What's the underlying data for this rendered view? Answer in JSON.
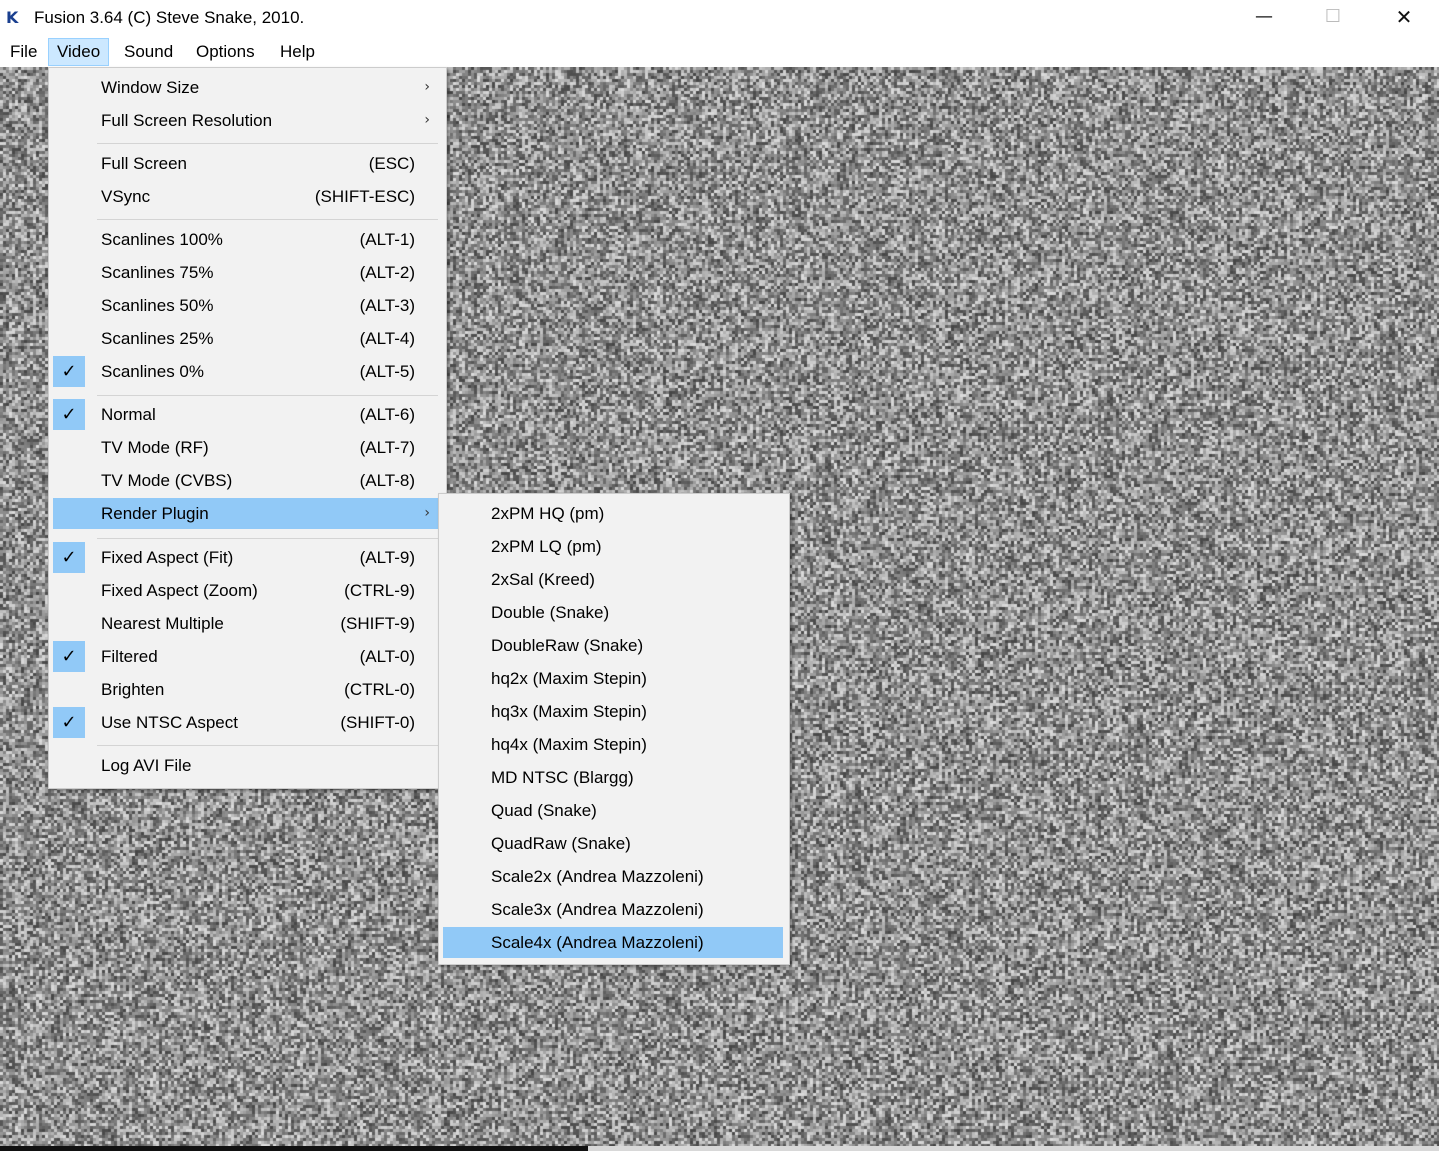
{
  "window": {
    "title": "Fusion 3.64 (C) Steve Snake, 2010.",
    "icon": "fusion-app-icon",
    "icon_glyph": "K",
    "minimize_glyph": "—",
    "maximize_glyph": "☐",
    "close_glyph": "✕"
  },
  "menubar": {
    "file": "File",
    "video": "Video",
    "sound": "Sound",
    "options": "Options",
    "help": "Help"
  },
  "video_menu": {
    "items": [
      {
        "label": "Window Size",
        "shortcut": "",
        "submenu": true,
        "checked": false
      },
      {
        "label": "Full Screen Resolution",
        "shortcut": "",
        "submenu": true,
        "checked": false
      },
      {
        "label": "Full Screen",
        "shortcut": "(ESC)",
        "checked": false
      },
      {
        "label": "VSync",
        "shortcut": "(SHIFT-ESC)",
        "checked": false
      },
      {
        "label": "Scanlines 100%",
        "shortcut": "(ALT-1)",
        "checked": false
      },
      {
        "label": "Scanlines 75%",
        "shortcut": "(ALT-2)",
        "checked": false
      },
      {
        "label": "Scanlines 50%",
        "shortcut": "(ALT-3)",
        "checked": false
      },
      {
        "label": "Scanlines 25%",
        "shortcut": "(ALT-4)",
        "checked": false
      },
      {
        "label": "Scanlines 0%",
        "shortcut": "(ALT-5)",
        "checked": true
      },
      {
        "label": "Normal",
        "shortcut": "(ALT-6)",
        "checked": true
      },
      {
        "label": "TV Mode (RF)",
        "shortcut": "(ALT-7)",
        "checked": false
      },
      {
        "label": "TV Mode (CVBS)",
        "shortcut": "(ALT-8)",
        "checked": false
      },
      {
        "label": "Render Plugin",
        "shortcut": "",
        "submenu": true,
        "checked": false,
        "highlighted": true
      },
      {
        "label": "Fixed Aspect (Fit)",
        "shortcut": "(ALT-9)",
        "checked": true
      },
      {
        "label": "Fixed Aspect (Zoom)",
        "shortcut": "(CTRL-9)",
        "checked": false
      },
      {
        "label": "Nearest Multiple",
        "shortcut": "(SHIFT-9)",
        "checked": false
      },
      {
        "label": "Filtered",
        "shortcut": "(ALT-0)",
        "checked": true
      },
      {
        "label": "Brighten",
        "shortcut": "(CTRL-0)",
        "checked": false
      },
      {
        "label": "Use NTSC Aspect",
        "shortcut": "(SHIFT-0)",
        "checked": true
      },
      {
        "label": "Log AVI File",
        "shortcut": "",
        "checked": false
      }
    ],
    "check_glyph": "✓",
    "arrow_glyph": "›"
  },
  "render_plugin_menu": {
    "items": [
      {
        "label": "2xPM HQ (pm)"
      },
      {
        "label": "2xPM LQ (pm)"
      },
      {
        "label": "2xSal (Kreed)"
      },
      {
        "label": "Double (Snake)"
      },
      {
        "label": "DoubleRaw (Snake)"
      },
      {
        "label": "hq2x (Maxim Stepin)"
      },
      {
        "label": "hq3x (Maxim Stepin)"
      },
      {
        "label": "hq4x (Maxim Stepin)"
      },
      {
        "label": "MD NTSC (Blargg)"
      },
      {
        "label": "Quad (Snake)"
      },
      {
        "label": "QuadRaw (Snake)"
      },
      {
        "label": "Scale2x (Andrea Mazzoleni)"
      },
      {
        "label": "Scale3x (Andrea Mazzoleni)"
      },
      {
        "label": "Scale4x (Andrea Mazzoleni)",
        "highlighted": true
      }
    ]
  },
  "colors": {
    "highlight": "#91c9f7",
    "menu_bg": "#f2f2f2",
    "menubar_active": "#cce8ff"
  }
}
